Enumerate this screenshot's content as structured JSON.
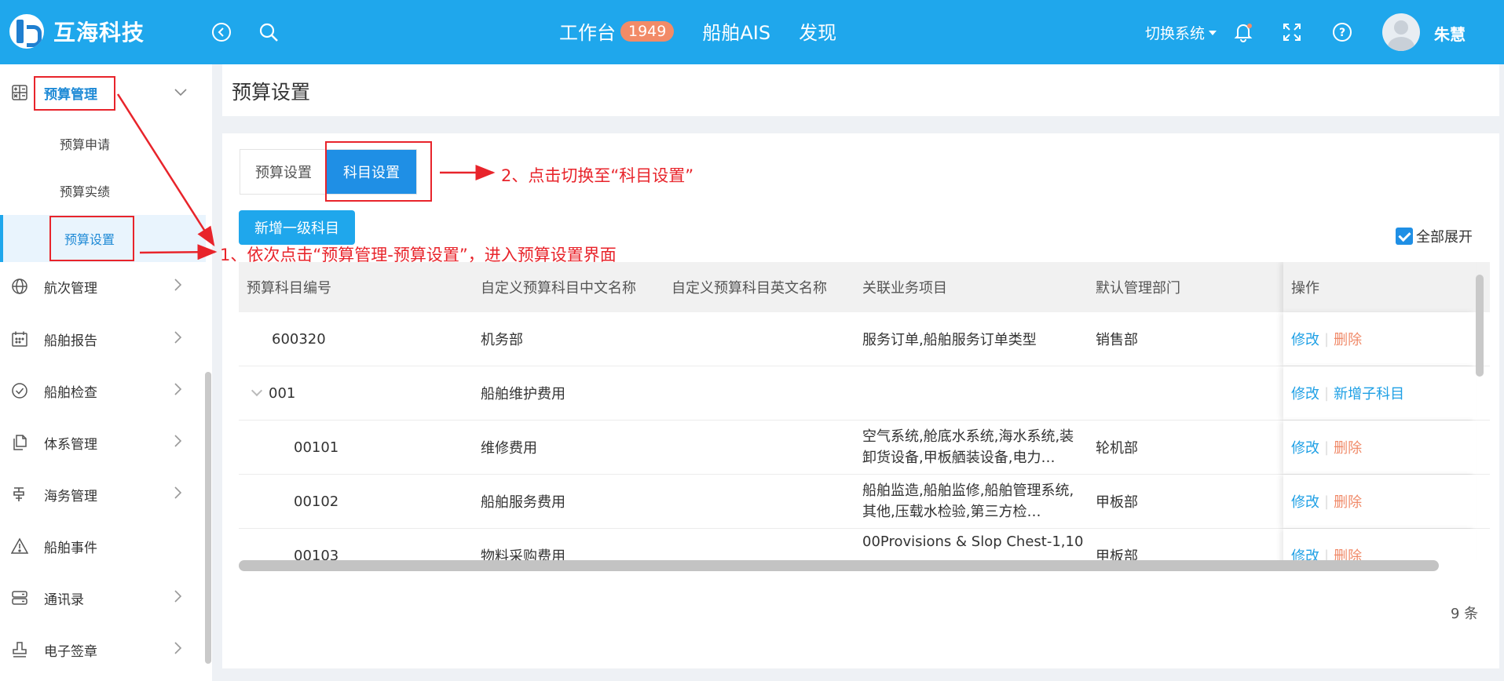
{
  "header": {
    "logo_text": "互海科技",
    "nav": [
      {
        "label": "工作台",
        "badge": "1949"
      },
      {
        "label": "船舶AIS"
      },
      {
        "label": "发现"
      }
    ],
    "system_switch": "切换系统",
    "user_name": "朱慧"
  },
  "sidebar": {
    "items": [
      {
        "label": "预算管理",
        "icon": "calculator-icon"
      },
      {
        "label": "预算申请"
      },
      {
        "label": "预算实绩"
      },
      {
        "label": "预算设置"
      },
      {
        "label": "航次管理",
        "icon": "globe-icon"
      },
      {
        "label": "船舶报告",
        "icon": "calendar-icon"
      },
      {
        "label": "船舶检查",
        "icon": "check-circle-icon"
      },
      {
        "label": "体系管理",
        "icon": "documents-icon"
      },
      {
        "label": "海务管理",
        "icon": "anchor-icon"
      },
      {
        "label": "船舶事件",
        "icon": "warning-icon"
      },
      {
        "label": "通讯录",
        "icon": "server-icon"
      },
      {
        "label": "电子签章",
        "icon": "stamp-icon"
      }
    ]
  },
  "page": {
    "title": "预算设置",
    "tabs": [
      "预算设置",
      "科目设置"
    ],
    "add_button": "新增一级科目",
    "expand_all": "全部展开",
    "total": "9 条"
  },
  "table": {
    "columns": [
      "预算科目编号",
      "自定义预算科目中文名称",
      "自定义预算科目英文名称",
      "关联业务项目",
      "默认管理部门",
      "操作"
    ],
    "rows": [
      {
        "code": "600320",
        "cn_name": "机务部",
        "en_name": "",
        "projects": "服务订单,船舶服务订单类型",
        "dept": "销售部",
        "op1": "修改",
        "op2": "删除"
      },
      {
        "code": "001",
        "cn_name": "船舶维护费用",
        "en_name": "",
        "projects": "",
        "dept": "",
        "op1": "修改",
        "op2": "新增子科目"
      },
      {
        "code": "00101",
        "cn_name": "维修费用",
        "en_name": "",
        "projects": "空气系统,舱底水系统,海水系统,装卸货设备,甲板舾装设备,电力…",
        "dept": "轮机部",
        "op1": "修改",
        "op2": "删除"
      },
      {
        "code": "00102",
        "cn_name": "船舶服务费用",
        "en_name": "",
        "projects": "船舶监造,船舶监修,船舶管理系统,其他,压载水检验,第三方检…",
        "dept": "甲板部",
        "op1": "修改",
        "op2": "删除"
      },
      {
        "code": "00103",
        "cn_name": "物料采购费用",
        "en_name": "",
        "projects": "00Provisions & Slop Chest-1,10",
        "dept": "甲板部",
        "op1": "修改",
        "op2": "删除"
      }
    ]
  },
  "annotations": {
    "step1": "1、依次点击“预算管理-预算设置”，进入预算设置界面",
    "step2": "2、点击切换至“科目设置”"
  },
  "colors": {
    "header_bg": "#1fa7ec",
    "accent": "#1f8fe5",
    "badge": "#f28b67",
    "delete_link": "#f08a69",
    "annotation": "#e8242b"
  }
}
